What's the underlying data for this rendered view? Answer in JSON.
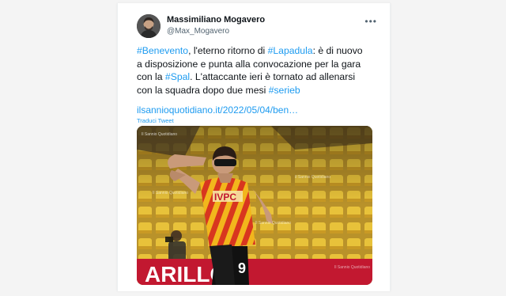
{
  "tweet": {
    "author": {
      "name": "Massimiliano Mogavero",
      "handle": "@Max_Mogavero"
    },
    "more_icon": "more-icon",
    "text": {
      "p1": "#Benevento",
      "p2": ", l'eterno ritorno di ",
      "p3": "#Lapadula",
      "p4": ": è di nuovo",
      "p5": "a disposizione e punta alla convocazione per la gara",
      "p6": "con la ",
      "p7": "#Spal",
      "p8": ". L'attaccante ieri è tornato ad allenarsi",
      "p9": "con la squadra dopo due mesi ",
      "p10": "#serieb"
    },
    "link": "ilsannioquotidiano.it/2022/05/04/ben…",
    "translate": "Traduci Tweet",
    "photo": {
      "watermark": "Il Sannio Quotidiano",
      "jersey_sponsor": "IVPC",
      "jersey_number": "9",
      "board_text": "ARILLO",
      "colors": {
        "seats": "#e8c23a",
        "jersey_red": "#d8361f",
        "jersey_yellow": "#f2b61c",
        "board": "#c21830"
      }
    }
  }
}
